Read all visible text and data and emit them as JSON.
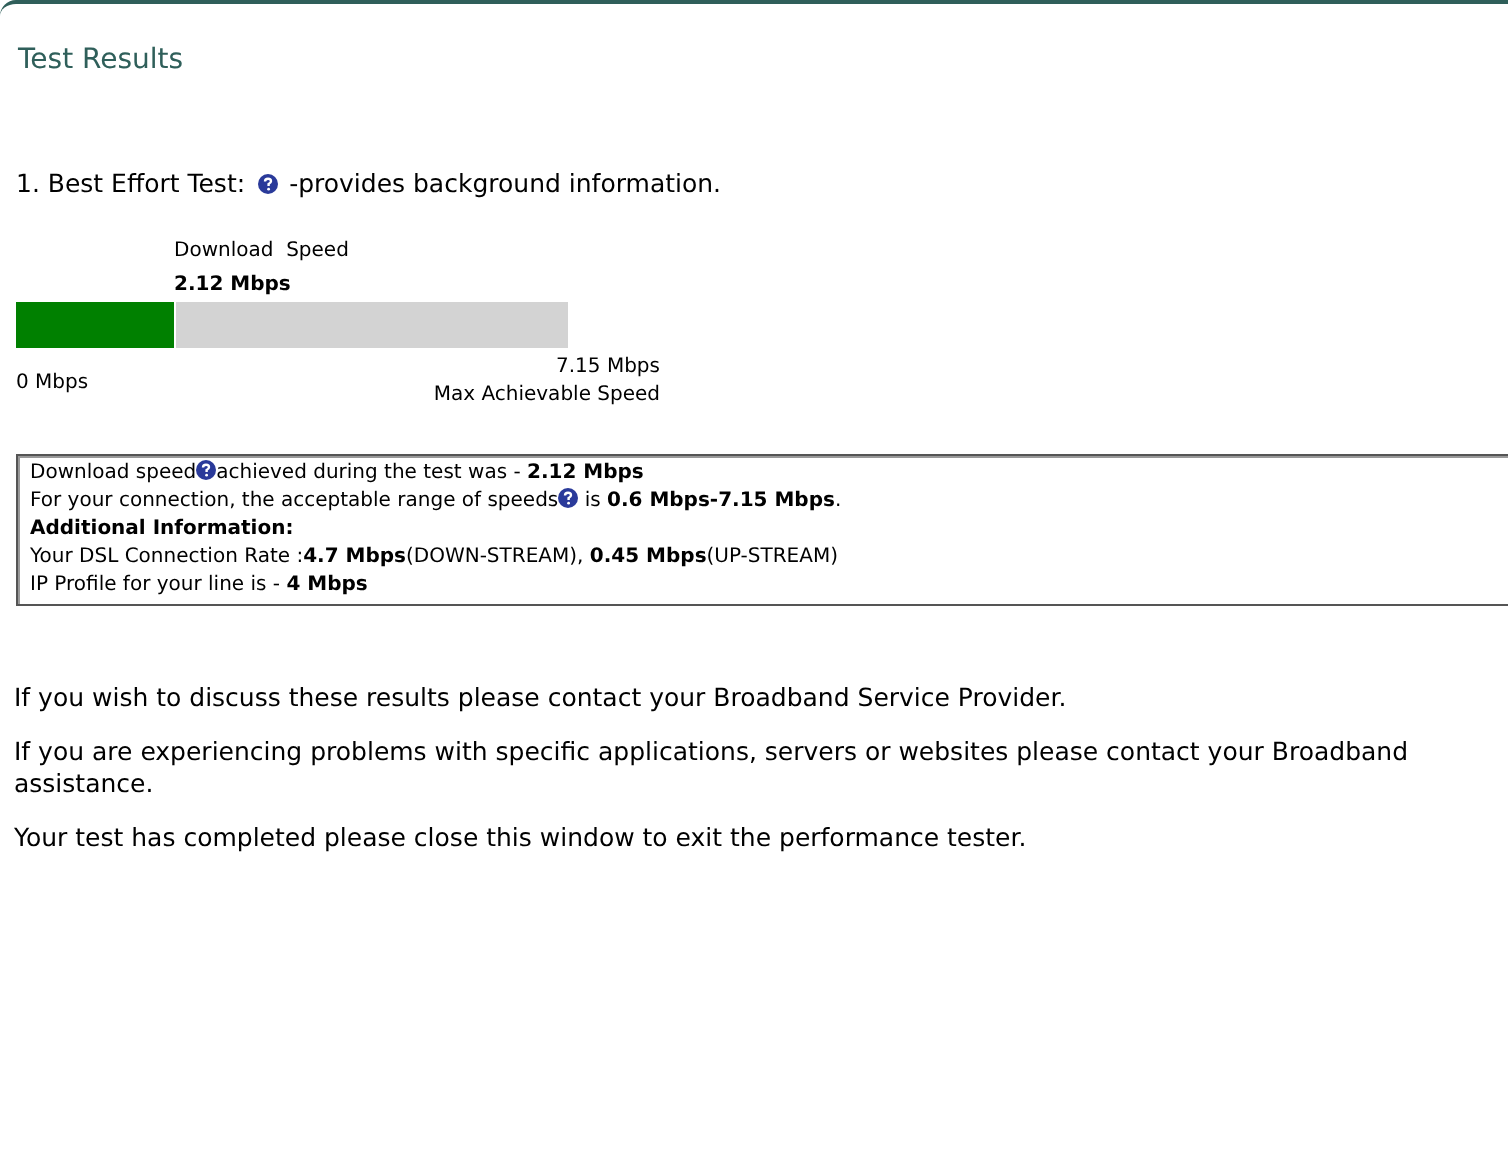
{
  "title": "Test Results",
  "test": {
    "heading_before": "1. Best Effort Test:",
    "heading_after": "-provides background information.",
    "speed_label": "Download  Speed",
    "speed_value": "2.12 Mbps",
    "level": 0.29,
    "min_label": "0 Mbps",
    "max_value": "7.15 Mbps",
    "max_label": "Max Achievable Speed"
  },
  "info": [
    [
      {
        "kind": "text",
        "text": "Download speed"
      },
      {
        "kind": "help"
      },
      {
        "kind": "text",
        "text": "achieved during the test was - **2.12 Mbps**"
      }
    ],
    [
      {
        "kind": "text",
        "text": "For your connection, the acceptable range of speeds"
      },
      {
        "kind": "help"
      },
      {
        "kind": "text",
        "text": " is **0.6 Mbps-7.15 Mbps**."
      }
    ],
    [
      {
        "kind": "text",
        "text": "**Additional Information:**"
      }
    ],
    [
      {
        "kind": "text",
        "text": "Your DSL Connection Rate :**4.7 Mbps**(DOWN-STREAM), **0.45 Mbps**(UP-STREAM)"
      }
    ],
    [
      {
        "kind": "text",
        "text": "IP Profile for your line is - **4 Mbps**"
      }
    ]
  ],
  "messages": [
    "If you wish to discuss these results please contact your Broadband Service Provider.",
    "If you are experiencing problems with specific applications, servers or websites please contact your Broadband",
    "assistance.",
    "Your test has completed please close this window to exit the performance tester."
  ]
}
